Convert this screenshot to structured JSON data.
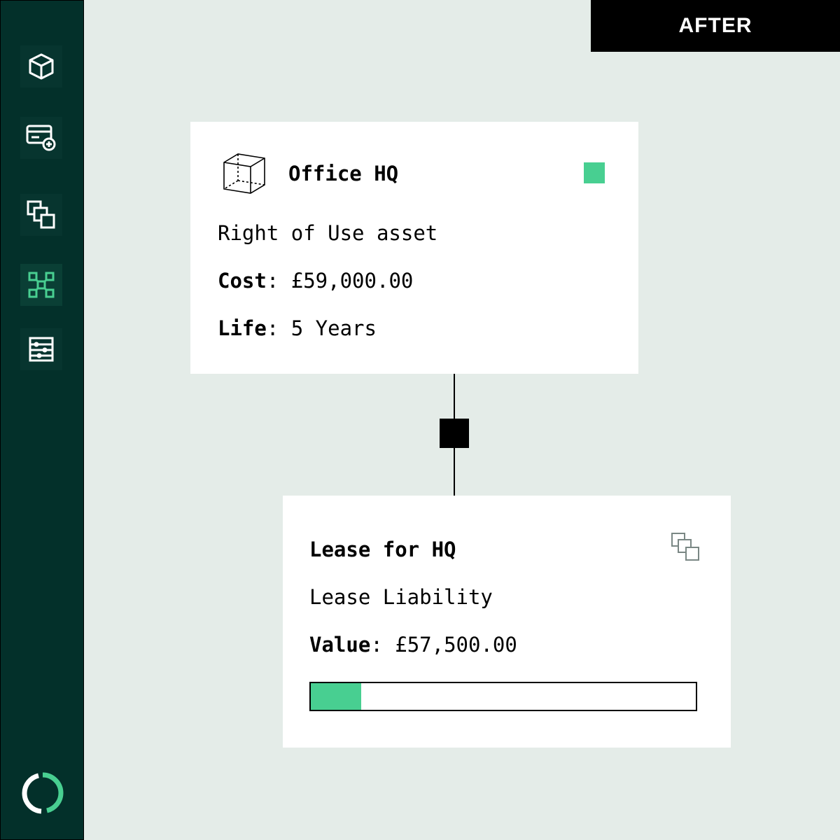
{
  "banner": {
    "label": "AFTER"
  },
  "sidebar": {
    "items": [
      {
        "icon": "cube-icon",
        "active": false
      },
      {
        "icon": "card-add-icon",
        "active": false
      },
      {
        "icon": "copy-icon",
        "active": false
      },
      {
        "icon": "network-icon",
        "active": true
      },
      {
        "icon": "ledger-icon",
        "active": false
      }
    ],
    "footer_icon": "loading-ring-icon"
  },
  "asset_card": {
    "title": "Office HQ",
    "subtitle": "Right of Use asset",
    "cost_label": "Cost",
    "cost_value": ": £59,000.00",
    "life_label": "Life",
    "life_value": ": 5 Years",
    "status_color": "#48cf91"
  },
  "lease_card": {
    "title": "Lease for HQ",
    "subtitle": "Lease Liability",
    "value_label": "Value",
    "value_amount": ": £57,500.00",
    "progress_fraction": 0.13
  },
  "colors": {
    "sidebar_bg": "#03302a",
    "accent": "#48cf91",
    "canvas_bg": "#e4ece8"
  }
}
